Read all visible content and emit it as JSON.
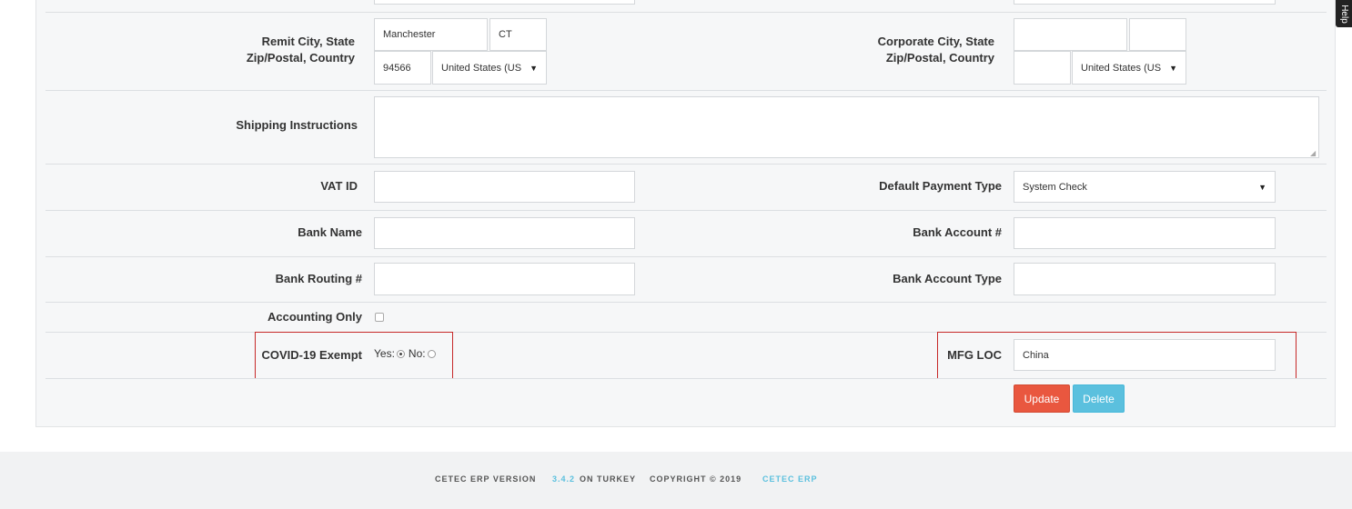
{
  "form": {
    "remit": {
      "label_line1": "Remit City, State",
      "label_line2": "Zip/Postal, Country",
      "city": "Manchester",
      "state": "CT",
      "zip": "94566",
      "country": "United States (US"
    },
    "corporate": {
      "label_line1": "Corporate City, State",
      "label_line2": "Zip/Postal, Country",
      "city": "",
      "state": "",
      "zip": "",
      "country": "United States (US"
    },
    "shipping_instructions": {
      "label": "Shipping Instructions",
      "value": ""
    },
    "vat_id": {
      "label": "VAT ID",
      "value": ""
    },
    "default_payment_type": {
      "label": "Default Payment Type",
      "value": "System Check"
    },
    "bank_name": {
      "label": "Bank Name",
      "value": ""
    },
    "bank_account_number": {
      "label": "Bank Account #",
      "value": ""
    },
    "bank_routing_number": {
      "label": "Bank Routing #",
      "value": ""
    },
    "bank_account_type": {
      "label": "Bank Account Type",
      "value": ""
    },
    "accounting_only": {
      "label": "Accounting Only",
      "checked": false
    },
    "covid_exempt": {
      "label": "COVID-19 Exempt",
      "yes_label": "Yes:",
      "no_label": "No:",
      "selected": "Yes"
    },
    "mfg_loc": {
      "label": "MFG LOC",
      "value": "China"
    }
  },
  "buttons": {
    "update": "Update",
    "delete": "Delete"
  },
  "footer": {
    "version_label": "CETEC ERP VERSION",
    "version": "3.4.2",
    "on_server": "ON TURKEY",
    "copyright": "COPYRIGHT © 2019",
    "brand_link": "CETEC ERP"
  },
  "side_tab": {
    "label": "Help"
  },
  "colors": {
    "update": "#e9573f",
    "delete": "#5bc0de",
    "highlight": "#c62828",
    "link": "#5bc0de"
  }
}
